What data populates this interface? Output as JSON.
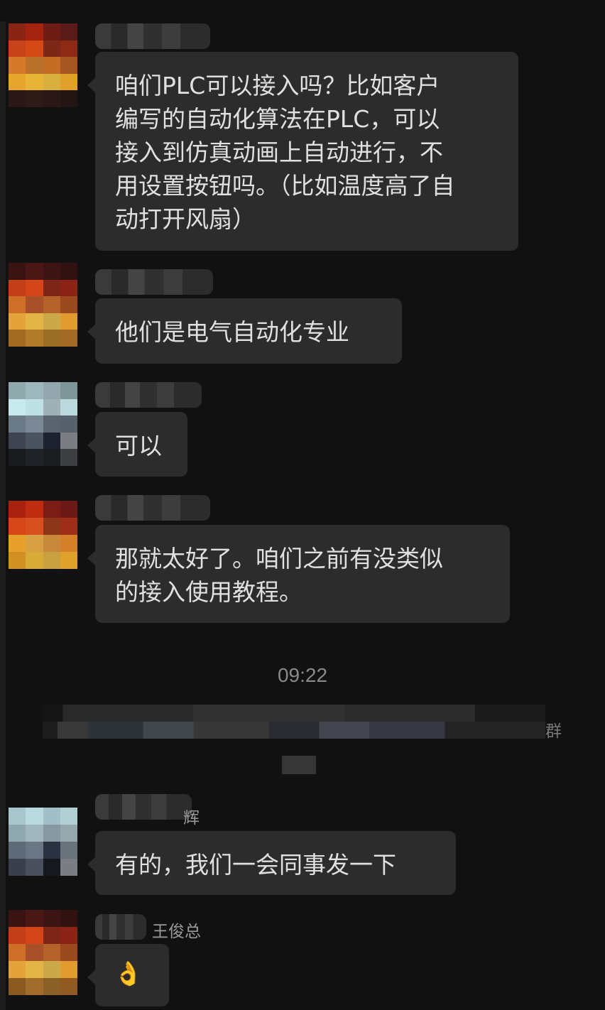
{
  "messages": [
    {
      "id": 1,
      "text": "咱们PLC可以接入吗？比如客户\n编写的自动化算法在PLC，可以\n接入到仿真动画上自动进行，不\n用设置按钮吗。（比如温度高了自\n动打开风扇）"
    },
    {
      "id": 2,
      "text": "他们是电气自动化专业"
    },
    {
      "id": 3,
      "text": "可以"
    },
    {
      "id": 4,
      "text": "那就太好了。咱们之前有没类似\n的接入使用教程。"
    },
    {
      "id": 5,
      "text": "有的，我们一会同事发一下",
      "name_tail": "辉"
    },
    {
      "id": 6,
      "text": "👌",
      "name_visible": "王俊总"
    }
  ],
  "timestamp": "09:22",
  "system_notice_tail": "群",
  "colors": {
    "background": "#111111",
    "bubble": "#2c2c2c",
    "text": "#e0e0e0",
    "muted": "#8a8a8a"
  }
}
